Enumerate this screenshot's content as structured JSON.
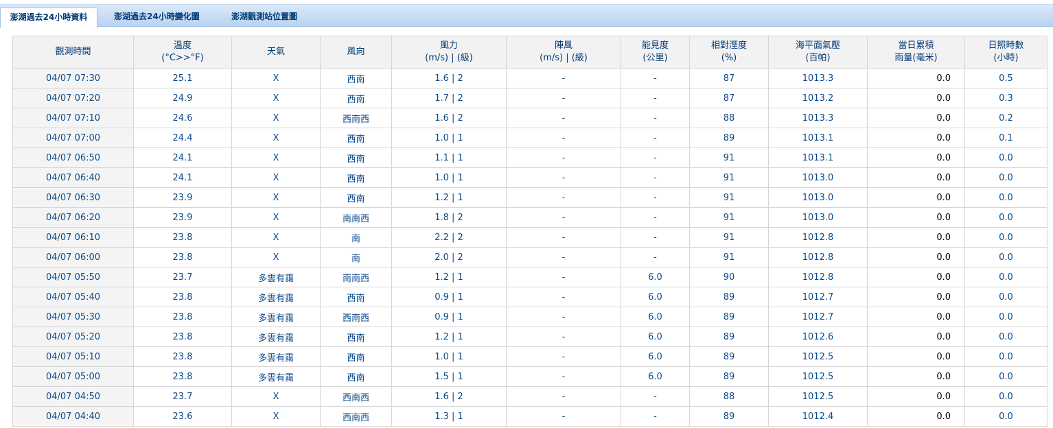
{
  "tabs": [
    {
      "label": "澎湖過去24小時資料",
      "active": true
    },
    {
      "label": "澎湖過去24小時變化圖",
      "active": false
    },
    {
      "label": "澎湖觀測站位置圖",
      "active": false
    }
  ],
  "table": {
    "headers": [
      {
        "line1": "觀測時間",
        "line2": ""
      },
      {
        "line1": "溫度",
        "line2": "(°C>>°F)"
      },
      {
        "line1": "天氣",
        "line2": ""
      },
      {
        "line1": "風向",
        "line2": ""
      },
      {
        "line1": "風力",
        "line2": "(m/s) | (級)"
      },
      {
        "line1": "陣風",
        "line2": "(m/s) | (級)"
      },
      {
        "line1": "能見度",
        "line2": "(公里)"
      },
      {
        "line1": "相對溼度",
        "line2": "(%)"
      },
      {
        "line1": "海平面氣壓",
        "line2": "(百帕)"
      },
      {
        "line1": "當日累積",
        "line2": "雨量(毫米)"
      },
      {
        "line1": "日照時數",
        "line2": "(小時)"
      }
    ],
    "rows": [
      [
        "04/07 07:30",
        "25.1",
        "X",
        "西南",
        "1.6 | 2",
        "-",
        "-",
        "87",
        "1013.3",
        "0.0",
        "0.5"
      ],
      [
        "04/07 07:20",
        "24.9",
        "X",
        "西南",
        "1.7 | 2",
        "-",
        "-",
        "87",
        "1013.2",
        "0.0",
        "0.3"
      ],
      [
        "04/07 07:10",
        "24.6",
        "X",
        "西南西",
        "1.6 | 2",
        "-",
        "-",
        "88",
        "1013.3",
        "0.0",
        "0.2"
      ],
      [
        "04/07 07:00",
        "24.4",
        "X",
        "西南",
        "1.0 | 1",
        "-",
        "-",
        "89",
        "1013.1",
        "0.0",
        "0.1"
      ],
      [
        "04/07 06:50",
        "24.1",
        "X",
        "西南",
        "1.1 | 1",
        "-",
        "-",
        "91",
        "1013.1",
        "0.0",
        "0.0"
      ],
      [
        "04/07 06:40",
        "24.1",
        "X",
        "西南",
        "1.0 | 1",
        "-",
        "-",
        "91",
        "1013.0",
        "0.0",
        "0.0"
      ],
      [
        "04/07 06:30",
        "23.9",
        "X",
        "西南",
        "1.2 | 1",
        "-",
        "-",
        "91",
        "1013.0",
        "0.0",
        "0.0"
      ],
      [
        "04/07 06:20",
        "23.9",
        "X",
        "南南西",
        "1.8 | 2",
        "-",
        "-",
        "91",
        "1013.0",
        "0.0",
        "0.0"
      ],
      [
        "04/07 06:10",
        "23.8",
        "X",
        "南",
        "2.2 | 2",
        "-",
        "-",
        "91",
        "1012.8",
        "0.0",
        "0.0"
      ],
      [
        "04/07 06:00",
        "23.8",
        "X",
        "南",
        "2.0 | 2",
        "-",
        "-",
        "91",
        "1012.8",
        "0.0",
        "0.0"
      ],
      [
        "04/07 05:50",
        "23.7",
        "多雲有靄",
        "南南西",
        "1.2 | 1",
        "-",
        "6.0",
        "90",
        "1012.8",
        "0.0",
        "0.0"
      ],
      [
        "04/07 05:40",
        "23.8",
        "多雲有靄",
        "西南",
        "0.9 | 1",
        "-",
        "6.0",
        "89",
        "1012.7",
        "0.0",
        "0.0"
      ],
      [
        "04/07 05:30",
        "23.8",
        "多雲有靄",
        "西南西",
        "0.9 | 1",
        "-",
        "6.0",
        "89",
        "1012.7",
        "0.0",
        "0.0"
      ],
      [
        "04/07 05:20",
        "23.8",
        "多雲有靄",
        "西南",
        "1.2 | 1",
        "-",
        "6.0",
        "89",
        "1012.6",
        "0.0",
        "0.0"
      ],
      [
        "04/07 05:10",
        "23.8",
        "多雲有靄",
        "西南",
        "1.0 | 1",
        "-",
        "6.0",
        "89",
        "1012.5",
        "0.0",
        "0.0"
      ],
      [
        "04/07 05:00",
        "23.8",
        "多雲有靄",
        "西南",
        "1.5 | 1",
        "-",
        "6.0",
        "89",
        "1012.5",
        "0.0",
        "0.0"
      ],
      [
        "04/07 04:50",
        "23.7",
        "X",
        "西南西",
        "1.6 | 2",
        "-",
        "-",
        "88",
        "1012.5",
        "0.0",
        "0.0"
      ],
      [
        "04/07 04:40",
        "23.6",
        "X",
        "西南西",
        "1.3 | 1",
        "-",
        "-",
        "89",
        "1012.4",
        "0.0",
        "0.0"
      ]
    ]
  },
  "colors": {
    "tab_text": "#003a75",
    "cell_text": "#0b4a8a",
    "header_bg": "#f2f2f2",
    "tabbar_bg": "#c7dcf4"
  }
}
